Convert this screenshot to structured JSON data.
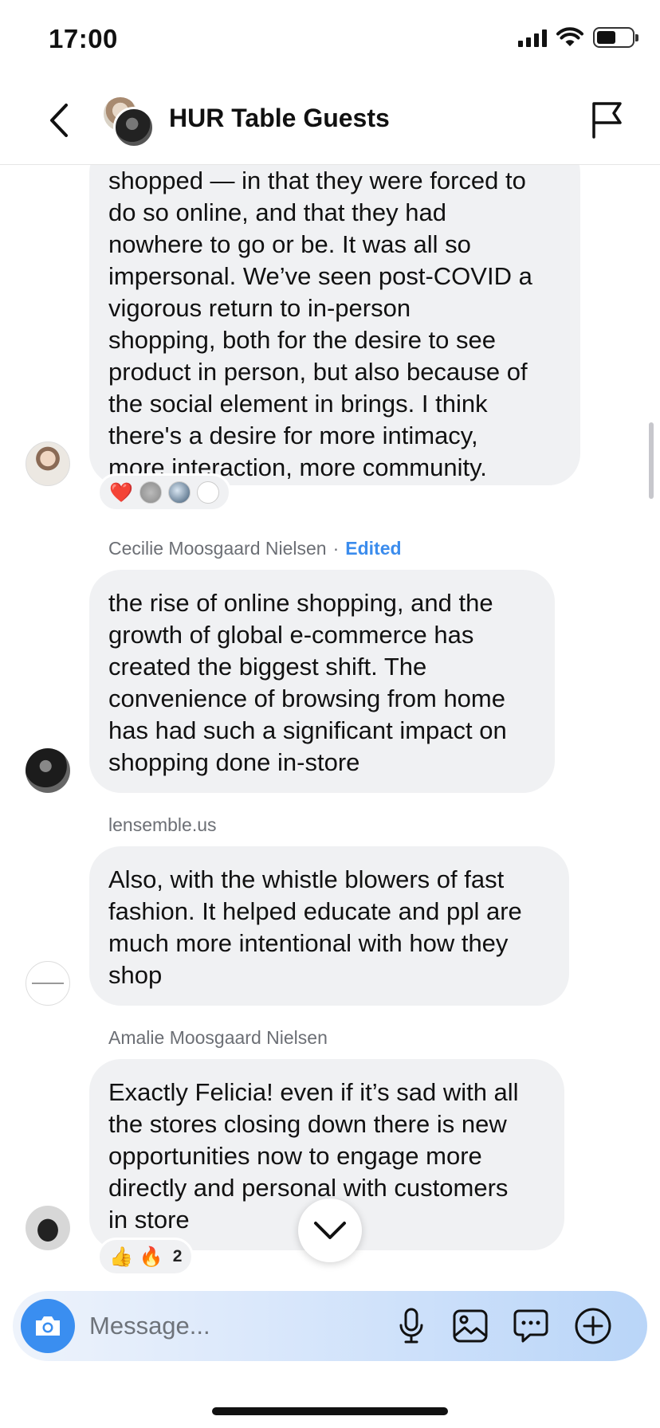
{
  "status_bar": {
    "time": "17:00"
  },
  "header": {
    "title": "HUR Table Guests"
  },
  "messages": [
    {
      "sender": "",
      "lines": [
        "shopped — in that they were forced to",
        "do so online, and that they had",
        "nowhere to go or be. It was all so",
        "impersonal. We’ve seen post-COVID a",
        "vigorous return to in-person",
        "shopping, both for the desire to see",
        "product in person, but also because of",
        "the social element in brings. I think",
        "there's a desire for more intimacy,",
        "more interaction, more community."
      ],
      "reactions": [
        "❤️"
      ]
    },
    {
      "sender": "Cecilie Moosgaard Nielsen",
      "edited_label": "Edited",
      "lines": [
        "the rise of online shopping, and the",
        "growth of global e-commerce has",
        "created the biggest shift. The",
        "convenience of browsing from home",
        "has had such a significant impact on",
        "shopping done in-store"
      ]
    },
    {
      "sender": "lensemble.us",
      "lines": [
        "Also, with the whistle blowers of fast",
        "fashion. It helped educate and ppl are",
        "much more intentional with how they",
        "shop"
      ]
    },
    {
      "sender": "Amalie Moosgaard Nielsen",
      "lines": [
        "Exactly Felicia! even if it’s sad with all",
        "the stores closing down there is new",
        "opportunities now to engage more",
        "directly and personal with customers",
        "in store"
      ],
      "reactions": [
        "👍",
        "🔥"
      ],
      "reaction_count": "2"
    }
  ],
  "composer": {
    "placeholder": "Message..."
  },
  "icons": {
    "back": "chevron-left-icon",
    "flag": "flag-icon",
    "camera": "camera-icon",
    "mic": "microphone-icon",
    "gallery": "image-icon",
    "sticker": "chat-bubble-icon",
    "add": "plus-circle-icon",
    "jump": "chevron-down-icon"
  },
  "colors": {
    "accent": "#3a8ef0",
    "bubble": "#f0f1f3",
    "edited": "#3b8ced"
  }
}
